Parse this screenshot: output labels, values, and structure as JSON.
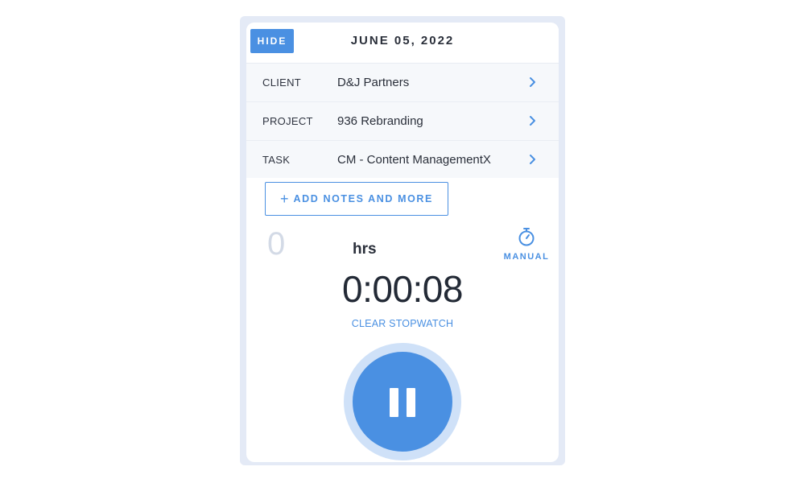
{
  "header": {
    "hide_label": "HIDE",
    "date": "JUNE 05, 2022"
  },
  "rows": [
    {
      "label": "CLIENT",
      "value": "D&J Partners"
    },
    {
      "label": "PROJECT",
      "value": "936 Rebranding"
    },
    {
      "label": "TASK",
      "value": "CM - Content ManagementX"
    }
  ],
  "add_notes": {
    "icon": "plus-icon",
    "label": "ADD NOTES AND MORE"
  },
  "hours": {
    "value": "0",
    "unit_label": "hrs"
  },
  "manual": {
    "icon": "stopwatch-icon",
    "label": "MANUAL"
  },
  "stopwatch": {
    "elapsed": "0:00:08",
    "clear_label": "CLEAR STOPWATCH"
  },
  "pause_button": {
    "icon": "pause-icon"
  },
  "colors": {
    "accent": "#4a90e2",
    "accent_light": "#cfe1f8",
    "text_dark": "#2a2f3a",
    "row_bg": "#f6f8fb",
    "frame_bg": "#e4eaf6"
  }
}
